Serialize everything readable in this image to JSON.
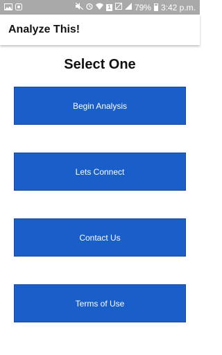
{
  "status_bar": {
    "battery": "79%",
    "time": "3:42 p.m.",
    "icons": [
      "image-icon",
      "notification-icon",
      "mute-icon",
      "alarm-icon",
      "wifi-icon",
      "sim-icon",
      "signal-icon",
      "battery-icon"
    ]
  },
  "app_bar": {
    "title": "Analyze This!"
  },
  "main": {
    "heading": "Select One",
    "buttons": [
      {
        "label": "Begin Analysis"
      },
      {
        "label": "Lets Connect"
      },
      {
        "label": "Contact Us"
      },
      {
        "label": "Terms of Use"
      }
    ]
  },
  "colors": {
    "button_bg": "#1a5fc9",
    "status_bar_bg": "#a9a9a9"
  }
}
